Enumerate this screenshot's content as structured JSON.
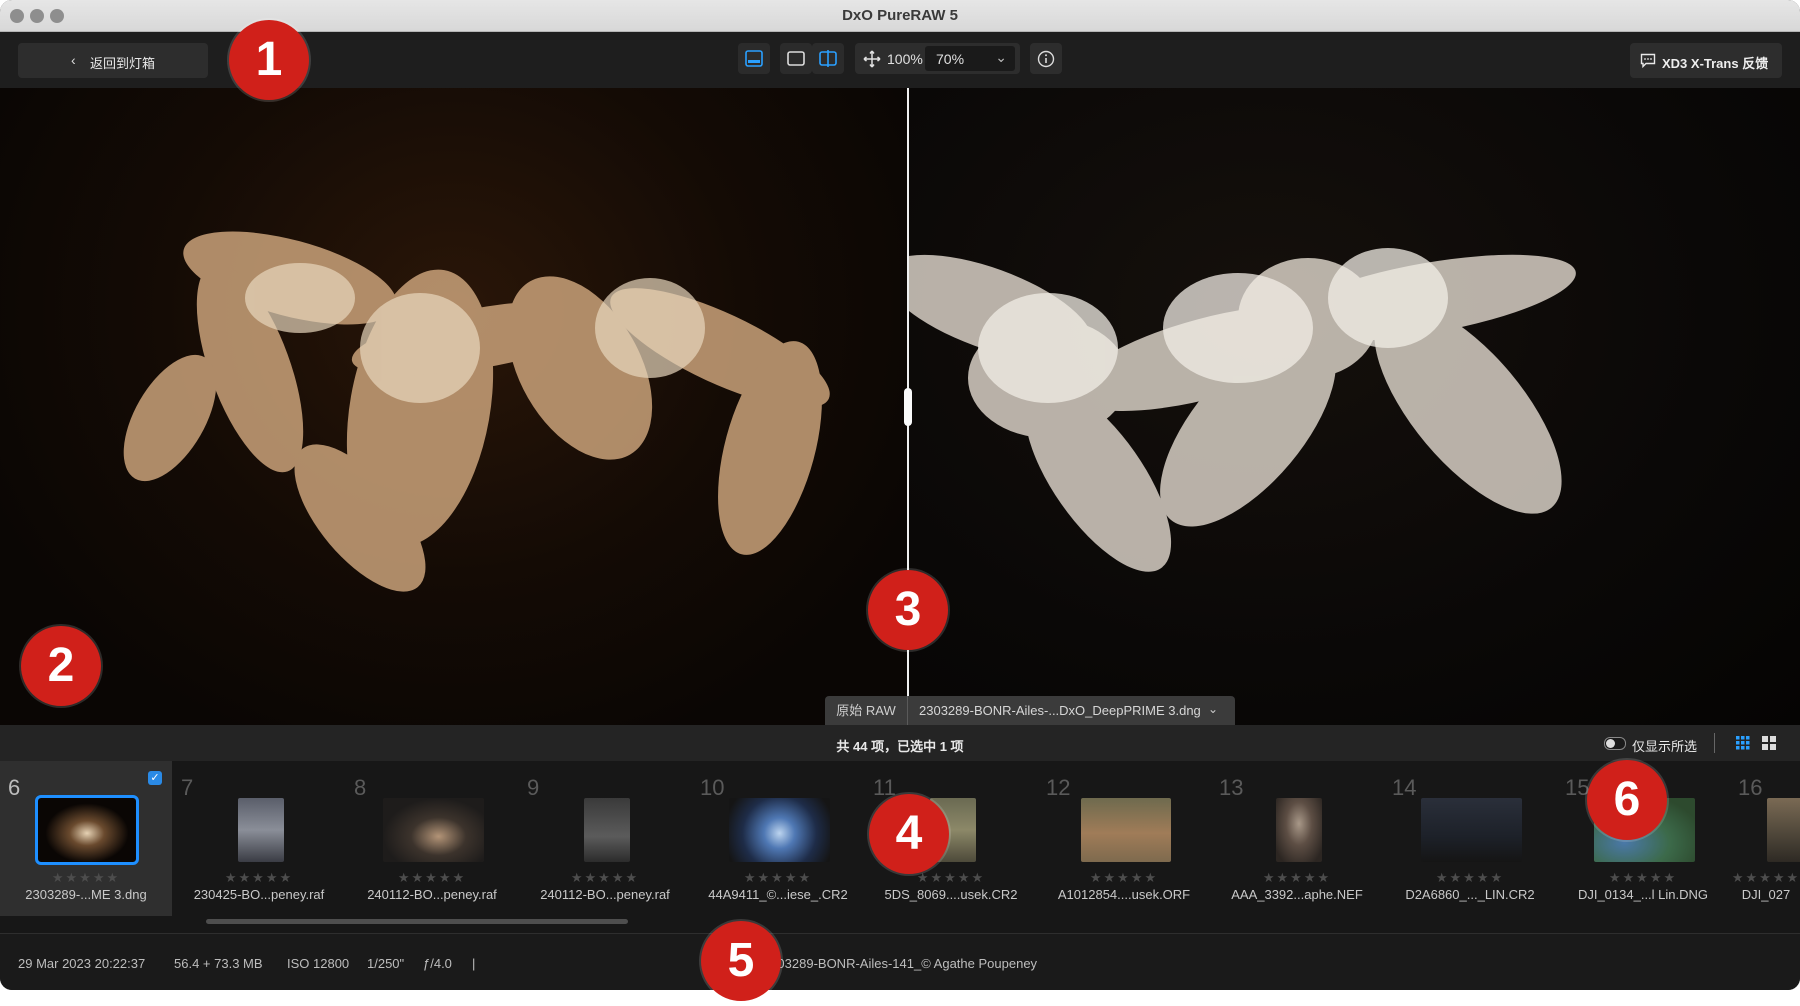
{
  "window": {
    "title": "DxO PureRAW 5"
  },
  "toolbar": {
    "back_label": "返回到灯箱",
    "zoom_100": "100%",
    "zoom_value": "70%",
    "feedback_label": "XD3 X-Trans 反馈"
  },
  "viewer": {
    "left_label": "原始 RAW",
    "right_label": "2303289-BONR-Ailes-...DxO_DeepPRIME 3.dng"
  },
  "film_header": {
    "selection_count": "共 44 项，已选中 1 项",
    "show_selected_label": "仅显示所选",
    "show_selected_on": false
  },
  "filmstrip": [
    {
      "num": "6",
      "name": "2303289-...ME 3.dng",
      "selected": true,
      "stars": "★★★★★"
    },
    {
      "num": "7",
      "name": "230425-BO...peney.raf",
      "selected": false,
      "stars": "★★★★★"
    },
    {
      "num": "8",
      "name": "240112-BO...peney.raf",
      "selected": false,
      "stars": "★★★★★"
    },
    {
      "num": "9",
      "name": "240112-BO...peney.raf",
      "selected": false,
      "stars": "★★★★★"
    },
    {
      "num": "10",
      "name": "44A9411_©...iese_.CR2",
      "selected": false,
      "stars": "★★★★★"
    },
    {
      "num": "11",
      "name": "5DS_8069....usek.CR2",
      "selected": false,
      "stars": "★★★★★"
    },
    {
      "num": "12",
      "name": "A1012854....usek.ORF",
      "selected": false,
      "stars": "★★★★★"
    },
    {
      "num": "13",
      "name": "AAA_3392...aphe.NEF",
      "selected": false,
      "stars": "★★★★★"
    },
    {
      "num": "14",
      "name": "D2A6860_..._LIN.CR2",
      "selected": false,
      "stars": "★★★★★"
    },
    {
      "num": "15",
      "name": "DJI_0134_...l Lin.DNG",
      "selected": false,
      "stars": "★★★★★"
    },
    {
      "num": "16",
      "name": "DJI_027",
      "selected": false,
      "stars": "★★★★★"
    }
  ],
  "status": {
    "date": "29 Mar 2023 20:22:37",
    "size": "56.4 + 73.3 MB",
    "iso": "ISO 12800",
    "shutter": "1/250\"",
    "aperture": "ƒ/4.0",
    "sep": "|",
    "filename": "2303289-BONR-Ailes-141_© Agathe Poupeney"
  },
  "markers": [
    "1",
    "2",
    "3",
    "4",
    "5",
    "6"
  ],
  "colors": {
    "accent": "#1e8fff",
    "marker": "#d0201a"
  }
}
